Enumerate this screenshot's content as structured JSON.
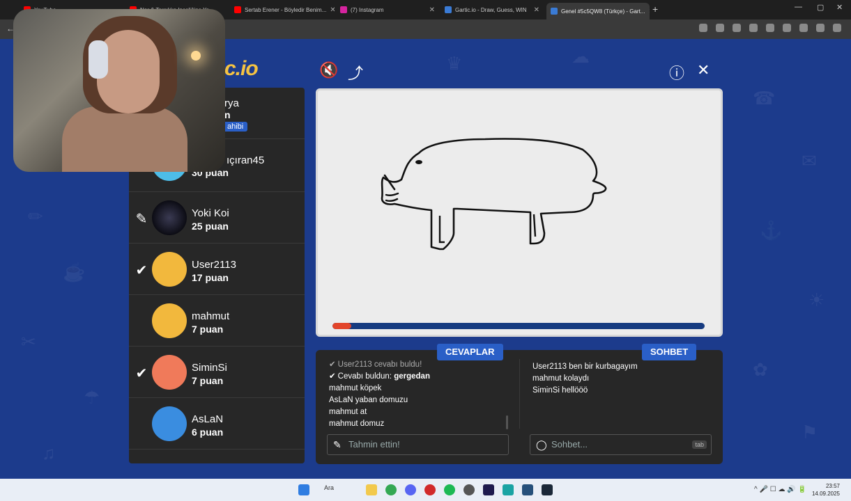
{
  "browser": {
    "tabs": [
      {
        "label": "YouTube",
        "color": "#ff0000"
      },
      {
        "label": "Nar & Tarçık'ın Inceliğine Yo...",
        "color": "#ff0000"
      },
      {
        "label": "Sertab Erener - Böyledir Benim...",
        "color": "#ff0000"
      },
      {
        "label": "(7) Instagram",
        "color": "#d6249f"
      },
      {
        "label": "Gartic.io - Draw, Guess, WIN",
        "color": "#3a7bd5"
      },
      {
        "label": "Genel #5c5QW8 (Türkçe) - Gart...",
        "color": "#3a7bd5"
      }
    ],
    "new_tab": "+",
    "back": "←",
    "window_controls": [
      "⌄",
      "—",
      "▢",
      "✕"
    ]
  },
  "logo": "c.io",
  "top_buttons": {
    "sound": "🔇",
    "share": "⤴",
    "info": "ⓘ",
    "close": "✕"
  },
  "players": [
    {
      "name": "rya",
      "score": "n",
      "badge": "ahibi",
      "mark": "",
      "avatar_color": "#7b5fd6"
    },
    {
      "name": "ıçıran45",
      "score": "30 puan",
      "mark": "",
      "avatar_color": "#4dbde8"
    },
    {
      "name": "Yoki Koi",
      "score": "25 puan",
      "mark": "✎",
      "avatar_color": "#1a1a26"
    },
    {
      "name": "User2113",
      "score": "17 puan",
      "mark": "✔",
      "avatar_color": "#f2b83d"
    },
    {
      "name": "mahmut",
      "score": "7 puan",
      "mark": "",
      "avatar_color": "#f2b83d"
    },
    {
      "name": "SiminSi",
      "score": "7 puan",
      "mark": "✔",
      "avatar_color": "#f07a5a"
    },
    {
      "name": "AsLaN",
      "score": "6 puan",
      "mark": "",
      "avatar_color": "#3a8de0"
    }
  ],
  "timer": {
    "progress_fraction": 0.05,
    "fill_color": "#e2452b",
    "track_color": "#163b80"
  },
  "answers_label": "CEVAPLAR",
  "chat_label": "SOHBET",
  "answers": [
    {
      "check": "✔",
      "prefix": "User2113",
      "text": " cevabı buldu!",
      "bold": "",
      "faded": true
    },
    {
      "check": "✔",
      "prefix": "",
      "text": "Cevabı buldun: ",
      "bold": "gergedan",
      "faded": false
    },
    {
      "check": "",
      "prefix": "",
      "text": "mahmut köpek",
      "bold": "",
      "faded": false
    },
    {
      "check": "",
      "prefix": "",
      "text": "AsLaN yaban domuzu",
      "bold": "",
      "faded": false
    },
    {
      "check": "",
      "prefix": "",
      "text": "mahmut at",
      "bold": "",
      "faded": false
    },
    {
      "check": "",
      "prefix": "",
      "text": "mahmut domuz",
      "bold": "",
      "faded": false
    }
  ],
  "chat": [
    "User2113 ben bir kurbagayım",
    "mahmut kolaydı",
    "SiminSi hellööö"
  ],
  "guess_input": {
    "placeholder": "Tahmin ettin!",
    "icon": "✎"
  },
  "chat_input": {
    "placeholder": "Sohbet...",
    "key_hint": "tab"
  },
  "taskbar": {
    "search_label": "Ara",
    "time": "23:57",
    "date": "14.09.2025",
    "tray": "^  🎤  ☐  ☁  🔊  🔋"
  }
}
